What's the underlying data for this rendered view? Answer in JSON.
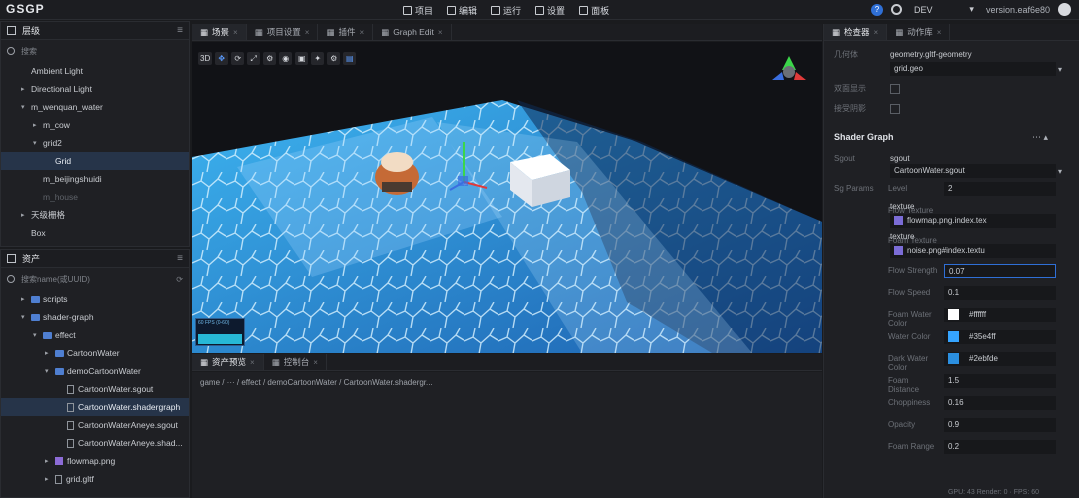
{
  "app": {
    "logo": "GSGP"
  },
  "menu": {
    "items": [
      {
        "label": "项目",
        "icon": "grid-icon"
      },
      {
        "label": "编辑",
        "icon": "pencil-icon"
      },
      {
        "label": "运行",
        "icon": "play-icon"
      },
      {
        "label": "设置",
        "icon": "gear-icon"
      },
      {
        "label": "面板",
        "icon": "panel-icon"
      }
    ]
  },
  "topright": {
    "env": "DEV",
    "version": "version.eaf6e80"
  },
  "hierarchy": {
    "title": "层级",
    "search_placeholder": "搜索",
    "items": [
      {
        "label": "Ambient Light",
        "indent": 0,
        "arrow": ""
      },
      {
        "label": "Directional Light",
        "indent": 0,
        "arrow": "▸"
      },
      {
        "label": "m_wenquan_water",
        "indent": 0,
        "arrow": "▾"
      },
      {
        "label": "m_cow",
        "indent": 1,
        "arrow": "▸"
      },
      {
        "label": "grid2",
        "indent": 1,
        "arrow": "▾"
      },
      {
        "label": "Grid",
        "indent": 2,
        "arrow": "",
        "selected": true
      },
      {
        "label": "m_beijingshuidi",
        "indent": 1,
        "arrow": ""
      },
      {
        "label": "m_house",
        "indent": 1,
        "arrow": "",
        "dim": true
      },
      {
        "label": "天级栅格",
        "indent": 0,
        "arrow": "▸"
      },
      {
        "label": "Box",
        "indent": 0,
        "arrow": ""
      }
    ]
  },
  "assets": {
    "title": "资产",
    "search_placeholder": "搜索name(或UUID)",
    "items": [
      {
        "label": "scripts",
        "type": "folder",
        "indent": 1,
        "arrow": "▸"
      },
      {
        "label": "shader-graph",
        "type": "folder",
        "indent": 1,
        "arrow": "▾"
      },
      {
        "label": "effect",
        "type": "folder",
        "indent": 2,
        "arrow": "▾"
      },
      {
        "label": "CartoonWater",
        "type": "folder",
        "indent": 3,
        "arrow": "▸"
      },
      {
        "label": "demoCartoonWater",
        "type": "folder",
        "indent": 3,
        "arrow": "▾"
      },
      {
        "label": "CartoonWater.sgout",
        "type": "file",
        "indent": 4,
        "arrow": ""
      },
      {
        "label": "CartoonWater.shadergraph",
        "type": "file",
        "indent": 4,
        "arrow": "",
        "selected": true
      },
      {
        "label": "CartoonWaterAneye.sgout",
        "type": "file",
        "indent": 4,
        "arrow": ""
      },
      {
        "label": "CartoonWaterAneye.shad...",
        "type": "file",
        "indent": 4,
        "arrow": ""
      },
      {
        "label": "flowmap.png",
        "type": "image",
        "indent": 3,
        "arrow": "▸"
      },
      {
        "label": "grid.gltf",
        "type": "file",
        "indent": 3,
        "arrow": "▸"
      }
    ]
  },
  "viewport": {
    "tabs": [
      {
        "label": "场景",
        "active": true
      },
      {
        "label": "项目设置",
        "active": false
      },
      {
        "label": "插件",
        "active": false
      },
      {
        "label": "Graph Edit",
        "active": false
      }
    ],
    "toolbar": [
      "3D",
      "✥",
      "⟳",
      "⤢",
      "⚙",
      "◉",
      "▣",
      "✦",
      "⚙",
      "▤"
    ],
    "fps_label": "60 FPS (0-60)"
  },
  "assets_preview": {
    "tabs": [
      {
        "label": "资产预览",
        "active": true
      },
      {
        "label": "控制台",
        "active": false
      }
    ],
    "path": "game / ··· / effect / demoCartoonWater / CartoonWater.shadergr..."
  },
  "inspector": {
    "tabs": [
      {
        "label": "检查器",
        "active": true
      },
      {
        "label": "动作库",
        "active": false
      }
    ],
    "props_top": [
      {
        "label": "几何体",
        "value": "geometry.gltf-geometry",
        "sub": "grid.geo"
      },
      {
        "label": "双面显示",
        "checkbox": true
      },
      {
        "label": "接受阴影",
        "checkbox": true
      }
    ],
    "section": "Shader Graph",
    "sgout_label": "Sgout",
    "sgout_tag": "sgout",
    "sgout_value": "CartoonWater.sgout",
    "params_label": "Sg Params",
    "params": [
      {
        "label": "Level",
        "value": "2"
      },
      {
        "label": "Flow Texture",
        "tag": "texture",
        "value": "flowmap.png.index.tex"
      },
      {
        "label": "Foam Texture",
        "tag": "texture",
        "value": "noise.png#index.textu"
      },
      {
        "label": "Flow Strength",
        "value": "0.07",
        "editing": true
      },
      {
        "label": "Flow Speed",
        "value": "0.1"
      },
      {
        "label": "Foam Water Color",
        "value": "#ffffff",
        "swatch": "#ffffff"
      },
      {
        "label": "Water Color",
        "value": "#35e4ff",
        "swatch": "#35a4ff"
      },
      {
        "label": "Dark Water Color",
        "value": "#2ebfde",
        "swatch": "#2b8fe0"
      },
      {
        "label": "Foam Distance",
        "value": "1.5"
      },
      {
        "label": "Choppiness",
        "value": "0.16"
      },
      {
        "label": "Opacity",
        "value": "0.9"
      },
      {
        "label": "Foam Range",
        "value": "0.2"
      }
    ],
    "status": "GPU: 43 Render: 0 · FPS: 60"
  },
  "colors": {
    "accent": "#2f6fd6",
    "water": "#3aa0e8",
    "selected_row": "#263449"
  }
}
